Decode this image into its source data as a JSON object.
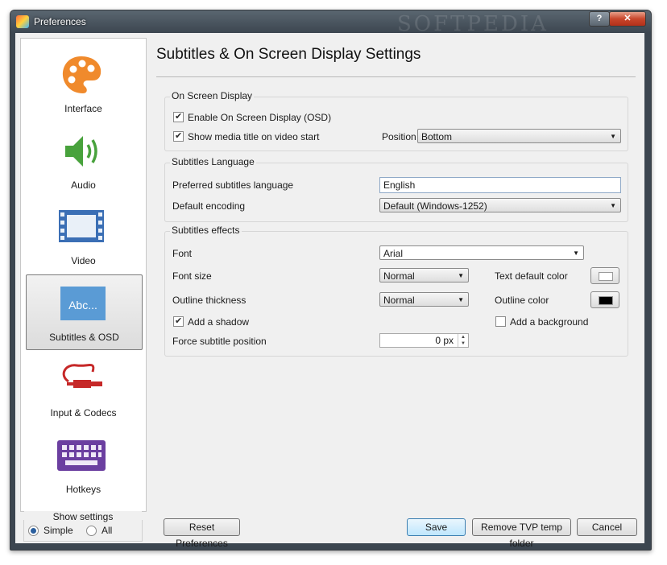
{
  "window": {
    "title": "Preferences",
    "watermark": "SOFTPEDIA"
  },
  "titlebar": {
    "help": "?",
    "close": "✕"
  },
  "sidebar": {
    "items": [
      {
        "label": "Interface",
        "icon": "palette-icon"
      },
      {
        "label": "Audio",
        "icon": "speaker-icon"
      },
      {
        "label": "Video",
        "icon": "film-icon"
      },
      {
        "label": "Subtitles & OSD",
        "icon": "subtitles-icon",
        "icon_text": "Abc...",
        "selected": true
      },
      {
        "label": "Input & Codecs",
        "icon": "cable-icon"
      },
      {
        "label": "Hotkeys",
        "icon": "keyboard-icon"
      }
    ],
    "show_settings": {
      "title": "Show settings",
      "options": [
        "Simple",
        "All"
      ],
      "selected": "Simple"
    }
  },
  "page": {
    "title": "Subtitles & On Screen Display Settings",
    "osd": {
      "group_title": "On Screen Display",
      "enable_osd": {
        "label": "Enable On Screen Display (OSD)",
        "checked": true
      },
      "show_title": {
        "label": "Show media title on video start",
        "checked": true
      },
      "position_label": "Position",
      "position_value": "Bottom"
    },
    "language": {
      "group_title": "Subtitles Language",
      "preferred_label": "Preferred subtitles language",
      "preferred_value": "English",
      "encoding_label": "Default encoding",
      "encoding_value": "Default (Windows-1252)"
    },
    "effects": {
      "group_title": "Subtitles effects",
      "font_label": "Font",
      "font_value": "Arial",
      "font_size_label": "Font size",
      "font_size_value": "Normal",
      "text_color_label": "Text default color",
      "text_color": "#ffffff",
      "outline_thickness_label": "Outline thickness",
      "outline_thickness_value": "Normal",
      "outline_color_label": "Outline color",
      "outline_color": "#000000",
      "shadow": {
        "label": "Add a shadow",
        "checked": true
      },
      "background": {
        "label": "Add a background",
        "checked": false
      },
      "force_position_label": "Force subtitle position",
      "force_position_value": "0 px"
    }
  },
  "buttons": {
    "reset": "Reset Preferences",
    "save": "Save",
    "remove_temp": "Remove TVP temp folder",
    "cancel": "Cancel"
  }
}
